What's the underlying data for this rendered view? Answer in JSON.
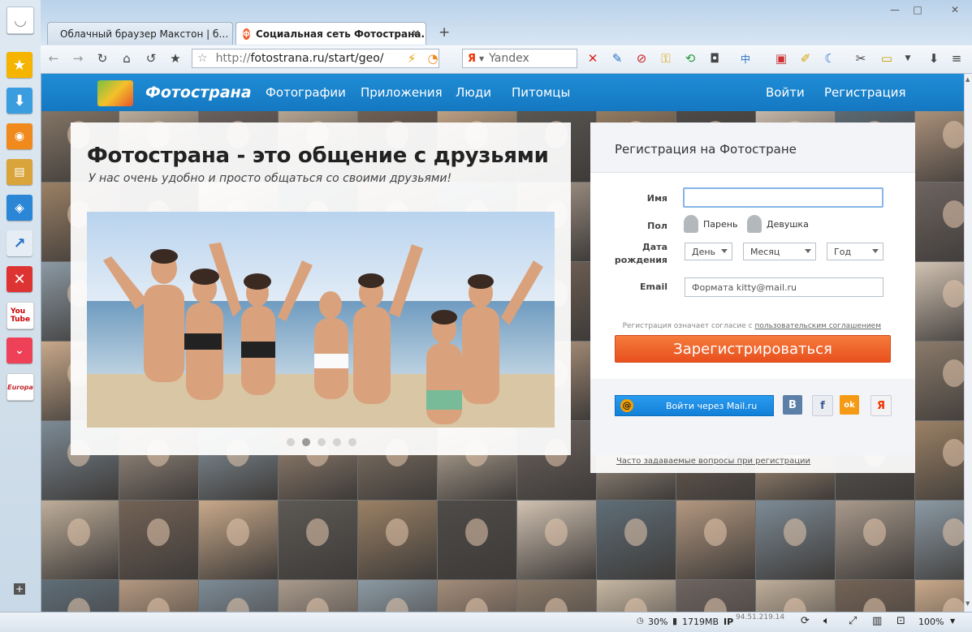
{
  "tabs": [
    {
      "label": "Облачный браузер Макстон | б…",
      "icon": "maxthon-page-icon"
    },
    {
      "label": "Социальная сеть Фотострана. …",
      "icon": "fotostrana-tab-icon"
    }
  ],
  "new_tab_symbol": "+",
  "toolbar": {
    "url_prefix": "http://",
    "url_host": "fotostrana.ru/start/geo/",
    "search_engine_letter": "Я",
    "search_placeholder": "Yandex"
  },
  "site": {
    "logo_text": "Фотострана",
    "nav": [
      "Фотографии",
      "Приложения",
      "Люди",
      "Питомцы"
    ],
    "login": "Войти",
    "register_link": "Регистрация",
    "hero_title": "Фотострана - это общение с друзьями",
    "hero_subtitle": "У нас очень удобно и просто общаться со своими друзьями!"
  },
  "registration": {
    "title": "Регистрация на Фотостране",
    "name_label": "Имя",
    "gender_label": "Пол",
    "gender_male": "Парень",
    "gender_female": "Девушка",
    "birth_label_1": "Дата",
    "birth_label_2": "рождения",
    "day": "День",
    "month": "Месяц",
    "year": "Год",
    "email_label": "Email",
    "email_placeholder": "Формата kitty@mail.ru",
    "agreement_text": "Регистрация означает согласие с",
    "agreement_link": "пользовательским соглашением",
    "submit": "Зарегистрироваться",
    "mailru_login": "Войти через Mail.ru",
    "social": [
      "В",
      "f",
      "ok",
      "Я"
    ],
    "faq_link": "Часто задаваемые вопросы при регистрации"
  },
  "status_bar": {
    "cpu": "30%",
    "memory": "1719MB",
    "ip_label": "IP",
    "ip_value": "94.51.219.14",
    "zoom": "100%"
  },
  "colors": {
    "nav_blue": "#1a84cc",
    "register_orange": "#f05a28",
    "mailru_blue": "#168de2"
  }
}
